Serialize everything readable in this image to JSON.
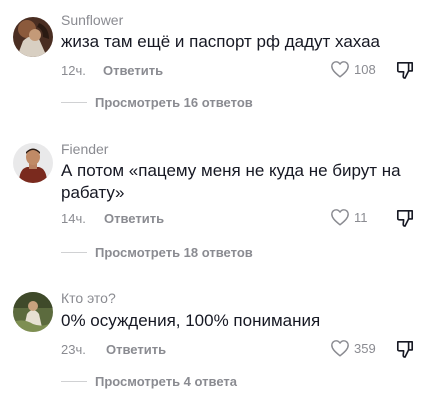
{
  "comments": [
    {
      "author": "Sunflower",
      "text": "жиза там ещё и паспорт рф дадут хахаа",
      "time": "12ч.",
      "reply_label": "Ответить",
      "likes": "108",
      "view_replies": "Просмотреть 16 ответов",
      "avatar_icon": "avatar-sunflower"
    },
    {
      "author": "Fiender",
      "text": "А потом «пацему меня не куда не бирут на рабату»",
      "time": "14ч.",
      "reply_label": "Ответить",
      "likes": "11",
      "view_replies": "Просмотреть 18 ответов",
      "avatar_icon": "avatar-fiender"
    },
    {
      "author": "Кто это?",
      "text": "0% осуждения, 100% понимания",
      "time": "23ч.",
      "reply_label": "Ответить",
      "likes": "359",
      "view_replies": "Просмотреть 4 ответа",
      "avatar_icon": "avatar-kto-eto"
    }
  ],
  "icons": {
    "like": "heart-outline-icon",
    "dislike": "thumb-down-outline-icon"
  },
  "colors": {
    "primary_text": "#161823",
    "secondary_text": "#8a8b91",
    "background": "#ffffff"
  }
}
